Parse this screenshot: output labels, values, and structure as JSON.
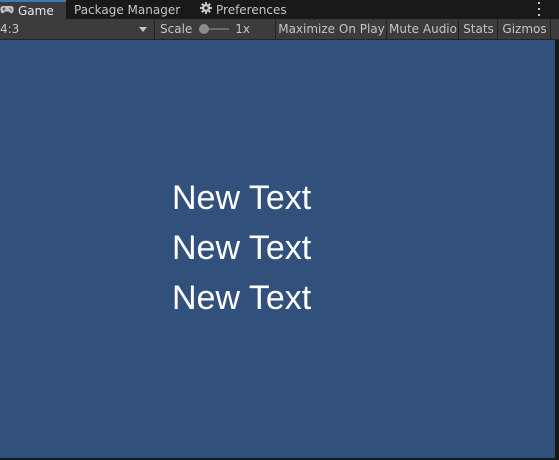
{
  "tabs": [
    {
      "label": "Game",
      "icon": "gamepad-icon",
      "active": true
    },
    {
      "label": "Package Manager",
      "active": false
    },
    {
      "label": "Preferences",
      "icon": "gear-icon",
      "active": false
    }
  ],
  "toolbar": {
    "aspect": "4:3",
    "scale_label": "Scale",
    "scale_value": "1x",
    "maximize_on_play": "Maximize On Play",
    "mute_audio": "Mute Audio",
    "stats": "Stats",
    "gizmos": "Gizmos"
  },
  "game_view": {
    "background": "#31507c",
    "texts": [
      "New Text",
      "New Text",
      "New Text"
    ]
  }
}
